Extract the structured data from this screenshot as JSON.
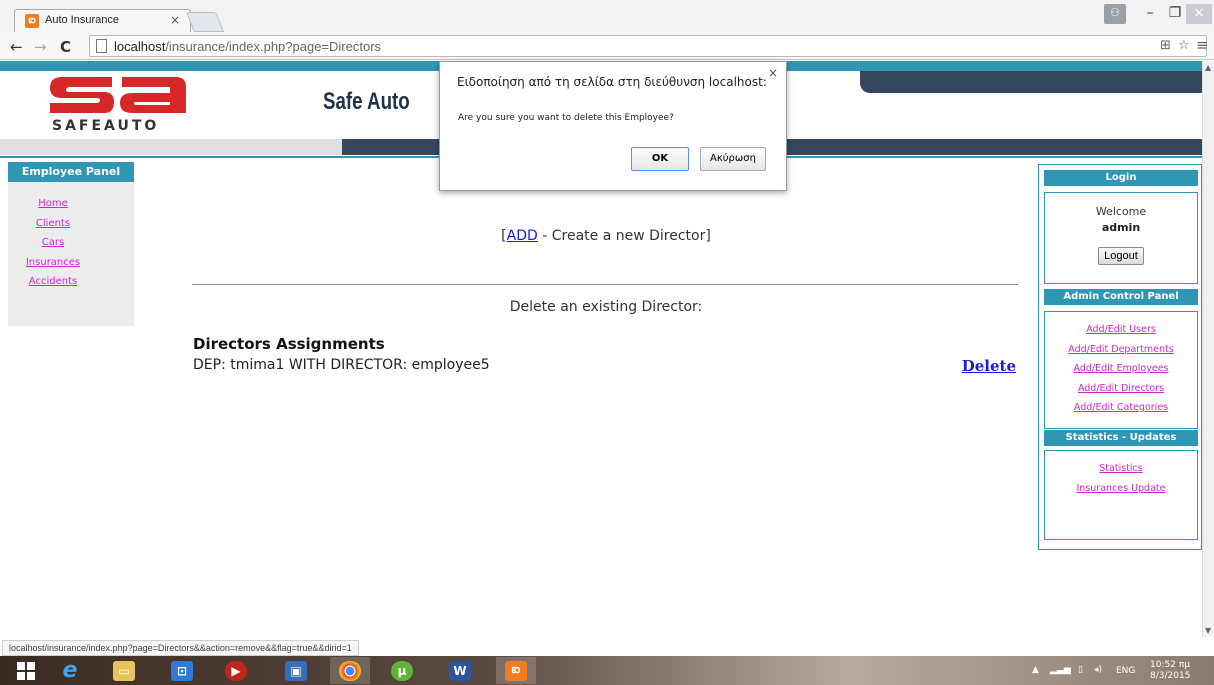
{
  "browser": {
    "tab_title": "Auto Insurance",
    "tab_close": "×",
    "url_host": "localhost",
    "url_path": "/insurance/index.php?page=Directors",
    "window_controls": {
      "minimize": "–",
      "maximize": "❐",
      "close": "×",
      "user": "⚇"
    },
    "nav": {
      "back": "←",
      "forward": "→",
      "reload": "C"
    }
  },
  "header": {
    "logo_text": "SAFEAUTO",
    "site_title": "Safe Auto"
  },
  "left_panel": {
    "title": "Employee Panel",
    "links": [
      {
        "label": "Home"
      },
      {
        "label": "Clients"
      },
      {
        "label": "Cars"
      },
      {
        "label": "Insurances"
      },
      {
        "label": "Accidents"
      }
    ]
  },
  "main": {
    "add_open": "[",
    "add_link": "ADD",
    "add_rest": " - Create a new Director]",
    "delete_heading": "Delete an existing Director:",
    "assignments_title": "Directors Assignments",
    "assignment_row": "DEP: tmima1 WITH DIRECTOR: employee5",
    "delete_link": "Delete"
  },
  "right_panel": {
    "login": {
      "title": "Login",
      "welcome": "Welcome",
      "user": "admin",
      "logout_button": "Logout"
    },
    "admin": {
      "title": "Admin Control Panel",
      "links": [
        {
          "label": "Add/Edit Users"
        },
        {
          "label": "Add/Edit Departments"
        },
        {
          "label": "Add/Edit Employees"
        },
        {
          "label": "Add/Edit Directors"
        },
        {
          "label": "Add/Edit Categories"
        }
      ]
    },
    "stats": {
      "title": "Statistics - Updates",
      "links": [
        {
          "label": "Statistics"
        },
        {
          "label": "Insurances Update"
        }
      ]
    }
  },
  "alert": {
    "title": "Ειδοποίηση από τη σελίδα στη διεύθυνση localhost:",
    "message": "Are you sure you want to delete this Employee?",
    "ok": "OK",
    "cancel": "Ακύρωση",
    "close": "×"
  },
  "status_bar": {
    "text": "localhost/insurance/index.php?page=Directors&&action=remove&&flag=true&&dirid=1"
  },
  "taskbar": {
    "lang": "ENG",
    "time": "10:52 πμ",
    "date": "8/3/2015"
  },
  "colors": {
    "teal": "#2f97b3",
    "navy": "#33485c",
    "link_magenta": "#d226d2",
    "link_blue": "#1a1ae6",
    "logo_red": "#d62828"
  }
}
